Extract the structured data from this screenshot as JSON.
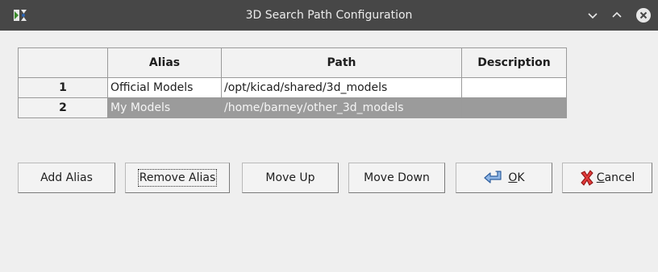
{
  "window": {
    "title": "3D Search Path Configuration",
    "icons": {
      "app": "kicad-app-icon",
      "minimize": "chevron-down-icon",
      "maximize": "chevron-up-icon",
      "close": "close-circle-icon"
    }
  },
  "grid": {
    "columns": [
      "Alias",
      "Path",
      "Description"
    ],
    "rows": [
      {
        "label": "1",
        "alias": "Official Models",
        "path": "/opt/kicad/shared/3d_models",
        "description": ""
      },
      {
        "label": "2",
        "alias": "My Models",
        "path": "/home/barney/other_3d_models",
        "description": "",
        "selected": true
      }
    ]
  },
  "buttons": {
    "add_alias": "Add Alias",
    "remove_alias": "Remove Alias",
    "move_up": "Move Up",
    "move_down": "Move Down",
    "ok": {
      "mnemonic": "O",
      "rest": "K",
      "icon": "enter-arrow-icon"
    },
    "cancel": {
      "mnemonic": "C",
      "rest": "ancel",
      "icon": "red-x-icon"
    }
  },
  "colors": {
    "titlebar": "#474747",
    "selection": "#9b9b9b",
    "background": "#efefef"
  }
}
